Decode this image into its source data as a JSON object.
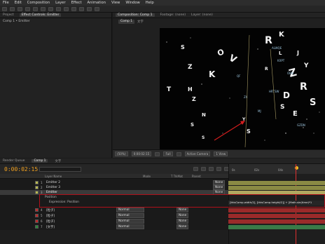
{
  "menu": [
    "File",
    "Edit",
    "Composition",
    "Layer",
    "Effect",
    "Animation",
    "View",
    "Window",
    "Help"
  ],
  "left_panel": {
    "tabs": [
      "Project",
      "Effect Controls: Emitter"
    ],
    "breadcrumb": "Comp 1 • Emitter"
  },
  "comp_panel": {
    "tabs": [
      "Composition: Comp 1",
      "Footage: (none)",
      "Layer: (none)"
    ],
    "subtab": "Comp 1",
    "subtab_extra": "文字"
  },
  "viewer_controls": {
    "zoom": "(50%)",
    "timecode": "0:00:02:15",
    "resolution": "Full",
    "camera": "Active Camera",
    "view": "1 View"
  },
  "timeline": {
    "tabs": [
      "Render Queue",
      "Comp 1",
      "文字"
    ],
    "timecode": "0:00:02:15",
    "col_layer_name": "Layer Name",
    "col_mode": "Mode",
    "col_trkmat": "T TrkMat",
    "col_parent": "Parent",
    "ruler_marks": [
      "0s",
      "02s",
      "04s"
    ],
    "expression_text": "[thisComp.width/2], [thisComp.height/2]] + [Math.sin(time)*1",
    "layers": [
      {
        "num": "1",
        "name": "Emitter 2",
        "mode": "",
        "parent": "None",
        "color": "#b8b850"
      },
      {
        "num": "2",
        "name": "Emitter 3",
        "mode": "",
        "parent": "None",
        "color": "#b8b850"
      },
      {
        "num": "3",
        "name": "Emitter",
        "mode": "",
        "parent": "None",
        "color": "#b8b850"
      },
      {
        "num": "",
        "name": "Position",
        "mode": "",
        "parent": "",
        "color": ""
      },
      {
        "num": "",
        "name": "Expression: Position",
        "mode": "",
        "parent": "",
        "color": ""
      },
      {
        "num": "4",
        "name": "[粒子]",
        "mode": "Normal",
        "parent": "None",
        "color": "#c02828"
      },
      {
        "num": "5",
        "name": "[粒子]",
        "mode": "Normal",
        "parent": "None",
        "color": "#c02828"
      },
      {
        "num": "6",
        "name": "[粒子]",
        "mode": "Normal",
        "parent": "None",
        "color": "#c02828"
      },
      {
        "num": "7",
        "name": "[文字]",
        "mode": "Normal",
        "parent": "None",
        "color": "#2a8a3a"
      }
    ]
  },
  "colors": {
    "accent_timecode": "#f0a020",
    "annotation_red": "#d41e1e"
  }
}
